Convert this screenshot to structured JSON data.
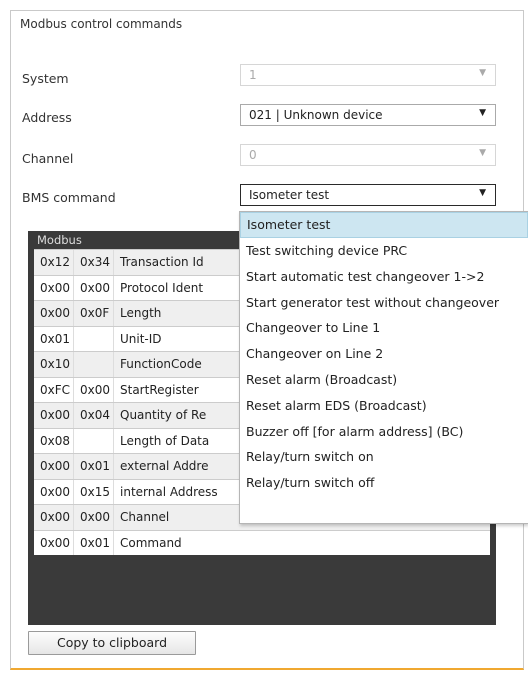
{
  "panel": {
    "title": "Modbus control commands"
  },
  "fields": [
    {
      "label": "System",
      "value": "1",
      "disabled": true
    },
    {
      "label": "Address",
      "value": "021 | Unknown device",
      "disabled": false
    },
    {
      "label": "Channel",
      "value": "0",
      "disabled": true
    },
    {
      "label": "BMS command",
      "value": "Isometer test",
      "disabled": false
    }
  ],
  "table": {
    "header": "Modbus",
    "rows": [
      {
        "b1": "0x12",
        "b2": "0x34",
        "desc": "Transaction Id"
      },
      {
        "b1": "0x00",
        "b2": "0x00",
        "desc": "Protocol Ident"
      },
      {
        "b1": "0x00",
        "b2": "0x0F",
        "desc": "Length"
      },
      {
        "b1": "0x01",
        "b2": "",
        "desc": "Unit-ID"
      },
      {
        "b1": "0x10",
        "b2": "",
        "desc": "FunctionCode"
      },
      {
        "b1": "0xFC",
        "b2": "0x00",
        "desc": "StartRegister"
      },
      {
        "b1": "0x00",
        "b2": "0x04",
        "desc": "Quantity of Re"
      },
      {
        "b1": "0x08",
        "b2": "",
        "desc": "Length of Data"
      },
      {
        "b1": "0x00",
        "b2": "0x01",
        "desc": "external Addre"
      },
      {
        "b1": "0x00",
        "b2": "0x15",
        "desc": "internal Address"
      },
      {
        "b1": "0x00",
        "b2": "0x00",
        "desc": "Channel"
      },
      {
        "b1": "0x00",
        "b2": "0x01",
        "desc": "Command"
      }
    ]
  },
  "dropdown": {
    "items": [
      "Isometer test",
      "Test switching device PRC",
      "Start automatic test changeover 1->2",
      "Start generator test without changeover",
      "Changeover to Line 1",
      "Changeover on Line 2",
      "Reset alarm (Broadcast)",
      "Reset alarm EDS (Broadcast)",
      "Buzzer off [for alarm address] (BC)",
      "Relay/turn switch on",
      "Relay/turn switch off"
    ],
    "selected": "Isometer test"
  },
  "buttons": {
    "copy": "Copy to clipboard"
  },
  "colors": {
    "accent_border": "#f0a830",
    "table_frame": "#3a3a3a",
    "selection": "#cde6f1"
  },
  "icons": {
    "dropdown_arrow": "chevron-down-icon"
  }
}
